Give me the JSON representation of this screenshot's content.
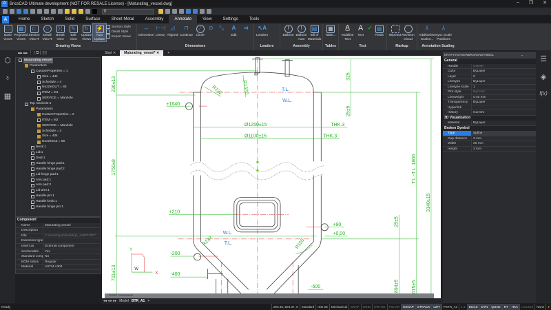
{
  "window": {
    "title": "BricsCAD Ultimate development (NOT FOR RESALE License) - [Maturating_vessel.dwg]",
    "app_icon": "A"
  },
  "quick_access": {
    "layer_value": "0"
  },
  "ribbon_tabs": [
    "Home",
    "Sketch",
    "Solid",
    "Surface",
    "Sheet Metal",
    "Assembly",
    "Annotate",
    "View",
    "Settings",
    "Tools"
  ],
  "active_tab": "Annotate",
  "ribbon": {
    "drawing_views": {
      "label": "Drawing Views",
      "buttons": [
        "Base Views",
        "Projected Views",
        "Section View ▾",
        "Detail View ▾",
        "Break View",
        "Edit View",
        "Update Views",
        "Auto Update"
      ],
      "small": [
        "Section Style",
        "Detail Style",
        "Export Views"
      ]
    },
    "dimensions": {
      "label": "Dimensions",
      "buttons": [
        "Dimension",
        "Linear",
        "Aligned",
        "Continue",
        "Circle",
        "Edit"
      ]
    },
    "leaders": {
      "label": "Leaders",
      "buttons": [
        "Leaders"
      ]
    },
    "assembly": {
      "label": "Assembly",
      "buttons": [
        "Balloon",
        "Balloon Auto",
        "Bill of Materials"
      ]
    },
    "tables": {
      "label": "Tables",
      "buttons": [
        "Table..."
      ]
    },
    "text": {
      "label": "Text",
      "buttons": [
        "Multiline Text",
        "Text",
        "Fields"
      ]
    },
    "markup": {
      "label": "Markup",
      "buttons": [
        "Wipeout",
        "Revision Cloud"
      ]
    },
    "annotation_scaling": {
      "label": "Annotation Scaling",
      "buttons": [
        "Add/Delete Scales...",
        "Sync Scale Positions"
      ]
    }
  },
  "doc_tabs": [
    "Start",
    "Maturating_vessel*",
    "+"
  ],
  "tree": [
    {
      "label": "Maturating vessel",
      "level": 0,
      "root": true
    },
    {
      "label": "Parameters",
      "level": 1,
      "folder": true
    },
    {
      "label": "CustomProperties = 1",
      "level": 2
    },
    {
      "label": "Size = 44k",
      "level": 3
    },
    {
      "label": "Schedule = 4",
      "level": 3
    },
    {
      "label": "NozzleOUT = 85",
      "level": 3
    },
    {
      "label": "ITEM = M1",
      "level": 3
    },
    {
      "label": "SERVICE = Manhole",
      "level": 3
    },
    {
      "label": "Top manhole:1",
      "level": 1
    },
    {
      "label": "Parameters",
      "level": 2,
      "folder": true
    },
    {
      "label": "CustomProperties = 2",
      "level": 3,
      "folder": true
    },
    {
      "label": "ITEM = M2",
      "level": 3
    },
    {
      "label": "SERVICE = Manhole",
      "level": 3,
      "folder": true
    },
    {
      "label": "Schedule = 3",
      "level": 3,
      "folder": true
    },
    {
      "label": "Size = 40k",
      "level": 3,
      "folder": true
    },
    {
      "label": "NozzleOut = 65",
      "level": 3,
      "folder": true
    },
    {
      "label": "Neck:1",
      "level": 2
    },
    {
      "label": "Lid:1",
      "level": 2
    },
    {
      "label": "Seal:1",
      "level": 2
    },
    {
      "label": "Handle hinge pad:1",
      "level": 2
    },
    {
      "label": "Handle hinge pad:2",
      "level": 2
    },
    {
      "label": "Lid hinge pad:1",
      "level": 2
    },
    {
      "label": "Arm pad:1",
      "level": 2
    },
    {
      "label": "Arm pad:2",
      "level": 2
    },
    {
      "label": "Lid arm:1",
      "level": 2
    },
    {
      "label": "Handle pin:1",
      "level": 2
    },
    {
      "label": "Handle knob:1",
      "level": 2
    },
    {
      "label": "Handle hinge pin:1",
      "level": 2
    }
  ],
  "component": {
    "header": "Component",
    "rows": [
      {
        "k": "Name",
        "v": "Maturating vessel"
      },
      {
        "k": "Description",
        "v": ""
      },
      {
        "k": "File",
        "v": "C:\\Users\\lyat\\Desktop\\_SUPPORT\\"
      },
      {
        "k": "Extension type",
        "v": ""
      },
      {
        "k": "Insert as",
        "v": "External component"
      },
      {
        "k": "Sectionable",
        "v": "Yes"
      },
      {
        "k": "Standard compone",
        "v": "No"
      },
      {
        "k": "BOM status",
        "v": "Regular"
      },
      {
        "k": "Material",
        "v": "ASTM A304"
      }
    ]
  },
  "drawing": {
    "labels": {
      "tl": "T.L.",
      "wl": "W.L.",
      "d1250": "Ø1250±15",
      "d1100": "Ø1100±15",
      "thk": "THK.3",
      "r132": "R132",
      "r1320": "R1320",
      "r150": "R150",
      "p1640": "+1640",
      "p210": "+210",
      "p90": "+90",
      "p000": "+0,00",
      "m200": "-200",
      "m400": "-400",
      "m600": "-600",
      "v236": "236±13",
      "v1750": "1750±8",
      "v701": "701±13",
      "v325": "325",
      "v25a": "25±5",
      "v25b": "25±5",
      "tltl": "T.L.-T.L. 1800",
      "v3140": "3140±15",
      "v894": "894±5",
      "v1015": "1015±5",
      "ucs_y": "Y",
      "ucs_x": "X",
      "ucs_w": "W"
    }
  },
  "command_line": {
    "placeholder": ": Enter command"
  },
  "model_tabs": [
    "Model",
    "BTR_A1",
    "+"
  ],
  "properties": {
    "selector": "DRAFTINGVIEWBROKENSYMBOL",
    "sections": [
      {
        "header": "General",
        "rows": [
          {
            "k": "Handle",
            "v": "C3E89"
          },
          {
            "k": "Color",
            "v": "ByLayer"
          },
          {
            "k": "Layer",
            "v": "0"
          },
          {
            "k": "Linetype",
            "v": "ByLayer"
          },
          {
            "k": "Linetype scale",
            "v": "1"
          },
          {
            "k": "Plot style",
            "v": "ByColor"
          },
          {
            "k": "Lineweight",
            "v": "0.40 mm"
          },
          {
            "k": "Transparency",
            "v": "ByLayer"
          },
          {
            "k": "Hyperlink",
            "v": ""
          },
          {
            "k": "History",
            "v": "Current"
          }
        ]
      },
      {
        "header": "3D Visualization",
        "rows": [
          {
            "k": "Material",
            "v": "ByLayer"
          }
        ]
      },
      {
        "header": "Broken Symbol",
        "rows": [
          {
            "k": "Type",
            "v": "Spline"
          },
          {
            "k": "Gap distance",
            "v": "3 mm"
          },
          {
            "k": "Width",
            "v": "20 mm"
          },
          {
            "k": "Height",
            "v": "3 mm"
          }
        ]
      }
    ]
  },
  "status": {
    "ready": "Ready",
    "items": [
      "203.45, 504.37, 0",
      "Standard",
      "ISO-25",
      "Mechanical",
      "SNAP",
      "GRID",
      "ORTHO",
      "POLAR",
      "ESNAP",
      "STRACK",
      "LWT",
      "PSTR_A1",
      "1:1",
      "DUCS",
      "DYN",
      "QUAD",
      "RT",
      "HKA",
      "LOCKUI",
      "None"
    ]
  },
  "colors": {
    "accent": "#2a7be4",
    "dim": "#22b422",
    "center": "#e03030",
    "note": "#2a7be4"
  }
}
